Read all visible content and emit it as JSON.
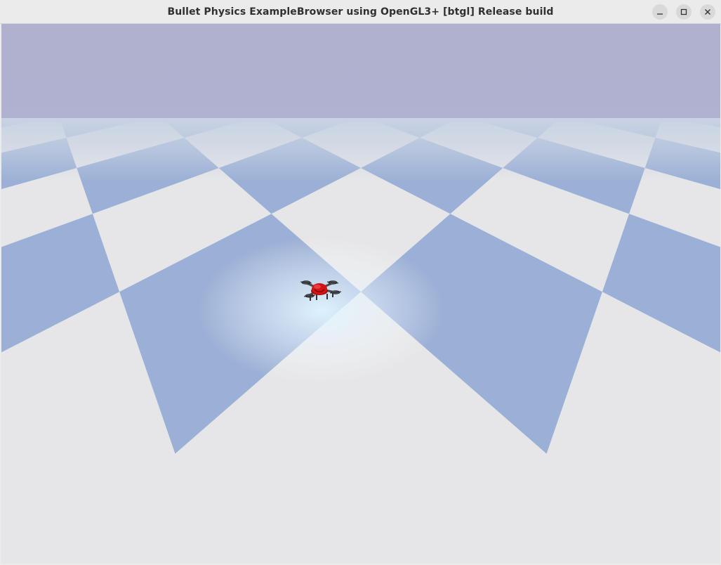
{
  "window": {
    "title": "Bullet Physics ExampleBrowser using OpenGL3+ [btgl] Release build"
  },
  "controls": {
    "minimize_icon": "minimize-icon",
    "maximize_icon": "maximize-icon",
    "close_icon": "close-icon"
  },
  "scene": {
    "sky_color": "#b0b0cf",
    "horizon_color": "#c6d0e2",
    "floor_light_color": "#e6e6e8",
    "floor_dark_color": "#9bb0d6",
    "spotlight_color": "#dff6ff",
    "drone_body_color": "#d41414"
  }
}
